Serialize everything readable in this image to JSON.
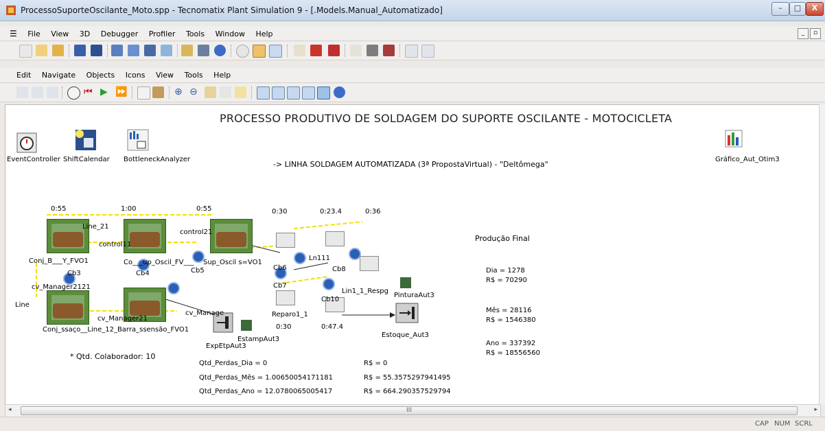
{
  "window": {
    "title": "ProcessoSuporteOscilante_Moto.spp - Tecnomatix Plant Simulation 9 - [.Models.Manual_Automatizado]",
    "buttons": {
      "minimize": "–",
      "maximize": "□",
      "close": "X"
    }
  },
  "menu_main": {
    "items": [
      "File",
      "View",
      "3D",
      "Debugger",
      "Profiler",
      "Tools",
      "Window",
      "Help"
    ]
  },
  "menu_sub": {
    "items": [
      "Edit",
      "Navigate",
      "Objects",
      "Icons",
      "View",
      "Tools",
      "Help"
    ]
  },
  "canvas": {
    "title": "PROCESSO PRODUTIVO DE SOLDAGEM DO SUPORTE OSCILANTE - MOTOCICLETA",
    "subtitle": "-> LINHA SOLDAGEM AUTOMATIZADA (3ª PropostaVirtual) - \"Deltômega\"",
    "tools": [
      {
        "label": "EventController",
        "icon": "event-controller-icon"
      },
      {
        "label": "ShiftCalendar",
        "icon": "shift-calendar-icon"
      },
      {
        "label": "BottleneckAnalyzer",
        "icon": "bottleneck-analyzer-icon"
      },
      {
        "label": "Gráfico_Aut_Otim3",
        "icon": "chart-icon"
      }
    ],
    "times": [
      "0:55",
      "1:00",
      "0:55",
      "0:30",
      "0:23.4",
      "0:36",
      "0:30",
      "0:47.4"
    ],
    "labels": {
      "line21": "Line_21",
      "control11": "control11",
      "control21": "control21",
      "conj_fvo1": "Conj_B___Y_FVO1",
      "co_osc": "Co___up_Oscil_FV___",
      "sup_osc": "Sup_Oscil s=VO1",
      "cb3": "Cb3",
      "cb4": "Cb4",
      "cb5": "Cb5",
      "cb6": "Cb6",
      "cb7": "Cb7",
      "cb8": "Cb8",
      "cb10": "Cb10",
      "cv_manager2121": "cv_Manager2121",
      "cv_manager21": "cv_Manager21",
      "cv_manage": "cv_Manage",
      "reparo": "Reparo1_1",
      "ln111": "Ln111",
      "ln111_respg": "Lin1_1_Respg",
      "line_left": "Line",
      "conj_lower": "Conj_ssaço__Line_12_Barra_ssensão_FVO1",
      "exp": "ExpEtpAut3",
      "estamp": "EstampAut3",
      "pintura": "PinturaAut3",
      "estoque": "Estoque_Aut3",
      "colab": "* Qtd. Colaborador: 10"
    },
    "production": {
      "heading": "Produção Final",
      "dia": "Dia = 1278",
      "dia_rs": "R$ = 70290",
      "mes": "Mês = 28116",
      "mes_rs": "R$ = 1546380",
      "ano": "Ano = 337392",
      "ano_rs": "R$ = 18556560"
    },
    "losses": {
      "dia": "Qtd_Perdas_Dia = 0",
      "dia_rs": "R$ = 0",
      "mes": "Qtd_Perdas_Mês = 1.00650054171181",
      "mes_rs": "R$ = 55.3575297941495",
      "ano": "Qtd_Perdas_Ano = 12.0780065005417",
      "ano_rs": "R$ = 664.290357529794"
    }
  },
  "scrollbar": {
    "thumb": "III"
  },
  "status": {
    "cap": "CAP",
    "num": "NUM",
    "scrl": "SCRL"
  },
  "colors": {
    "canvas": "#ffffff",
    "station_green": "#5b8d3a",
    "node_blue": "#2b5fb3",
    "titlebar": "#c3d5ea"
  }
}
